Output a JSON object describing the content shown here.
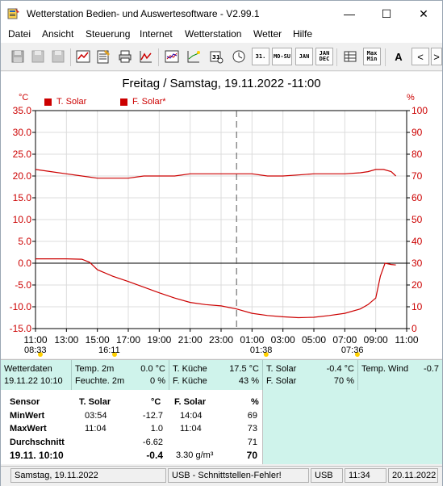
{
  "window": {
    "title": "Wetterstation Bedien- und Auswertesoftware - V2.99.1",
    "minimize_glyph": "—",
    "maximize_glyph": "☐",
    "close_glyph": "✕"
  },
  "menu": [
    "Datei",
    "Ansicht",
    "Steuerung",
    "Internet",
    "Wetterstation",
    "Wetter",
    "Hilfe"
  ],
  "toolbar": {
    "week_label": "MO-SU",
    "week_label2": "",
    "day_label": "31.",
    "month_label": "JAN",
    "year_label1": "JAN",
    "year_label2": "DEC",
    "maxmin_label1": "Max",
    "maxmin_label2": "Min",
    "font_label": "A",
    "prev_label": "<",
    "next_label": ">",
    "icons": [
      "save-icon",
      "save-disabled-icon",
      "chart-icon",
      "notes-icon",
      "print-icon",
      "graph-icon",
      "line-chart-icon",
      "plot-icon",
      "calendar-day-icon",
      "clock-icon"
    ]
  },
  "chart_data": {
    "type": "line",
    "title": "Freitag / Samstag, 19.11.2022  -11:00",
    "y_left_unit": "°C",
    "y_right_unit": "%",
    "ylim_left": [
      -15,
      35
    ],
    "ylim_right": [
      0,
      100
    ],
    "yticks_left": [
      "35.0",
      "30.0",
      "25.0",
      "20.0",
      "15.0",
      "10.0",
      "5.0",
      "0.0",
      "-5.0",
      "-10.0",
      "-15.0"
    ],
    "yticks_right": [
      "100",
      "90",
      "80",
      "70",
      "60",
      "50",
      "40",
      "30",
      "20",
      "10",
      "0"
    ],
    "xticks": [
      "11:00",
      "13:00",
      "15:00",
      "17:00",
      "19:00",
      "21:00",
      "23:00",
      "01:00",
      "03:00",
      "05:00",
      "07:00",
      "09:00",
      "11:00"
    ],
    "x_range_hours": [
      0,
      24
    ],
    "grid": true,
    "legend": "top-left",
    "colors": {
      "series": "#cc0000",
      "grid": "#dcdcdc",
      "axis": "#000000"
    },
    "markers": [
      {
        "label": "08:33",
        "x": 0
      },
      {
        "label": "16:11",
        "x": 4.8
      },
      {
        "label": "01:38",
        "x": 14.6
      },
      {
        "label": "07:36",
        "x": 20.5
      }
    ],
    "midnight_x": 13,
    "series": [
      {
        "name": "T. Solar",
        "axis": "left",
        "x": [
          0,
          1,
          2,
          3,
          3.5,
          4,
          5,
          6,
          7,
          8,
          9,
          10,
          11,
          12,
          13,
          14,
          15,
          16,
          17,
          18,
          19,
          20,
          21,
          21.5,
          22,
          22.3,
          22.6,
          23,
          23.3
        ],
        "y": [
          1,
          1,
          1,
          0.9,
          0.2,
          -1.5,
          -3,
          -4.2,
          -5.5,
          -6.8,
          -8,
          -9,
          -9.5,
          -9.8,
          -10.5,
          -11.5,
          -12,
          -12.3,
          -12.5,
          -12.4,
          -12,
          -11.5,
          -10.5,
          -9.5,
          -8,
          -3,
          0,
          -0.3,
          -0.4
        ]
      },
      {
        "name": "F. Solar*",
        "axis": "right",
        "x": [
          0,
          1,
          2,
          3,
          4,
          5,
          6,
          7,
          8,
          9,
          10,
          11,
          12,
          13,
          14,
          15,
          16,
          17,
          18,
          19,
          20,
          21,
          21.5,
          22,
          22.5,
          23,
          23.3
        ],
        "y": [
          73,
          72,
          71,
          70,
          69,
          69,
          69,
          70,
          70,
          70,
          71,
          71,
          71,
          71,
          71,
          70,
          70,
          70.5,
          71,
          71,
          71,
          71.5,
          72,
          73,
          73,
          72,
          70
        ]
      }
    ]
  },
  "current": {
    "wetterdaten_label": "Wetterdaten",
    "wetterdaten_time": "19.11.22 10:10",
    "temp2m_label": "Temp. 2m",
    "temp2m_value": "0.0 °C",
    "feuchte2m_label": "Feuchte. 2m",
    "feuchte2m_value": "0 %",
    "tkueche_label": "T. Küche",
    "tkueche_value": "17.5 °C",
    "fkueche_label": "F. Küche",
    "fkueche_value": "43 %",
    "tsolar_label": "T. Solar",
    "tsolar_value": "-0.4 °C",
    "fsolar_label": "F. Solar",
    "fsolar_value": "70 %",
    "wind_label": "Temp. Wind",
    "wind_value": "-0.7"
  },
  "stats": {
    "sensor_label": "Sensor",
    "col1_header": "T. Solar",
    "col1_unit": "°C",
    "col2_header": "F. Solar",
    "col2_unit": "%",
    "min_label": "MinWert",
    "min_time1": "03:54",
    "min_value1": "-12.7",
    "min_time2": "14:04",
    "min_value2": "69",
    "max_label": "MaxWert",
    "max_time1": "11:04",
    "max_value1": "1.0",
    "max_time2": "11:04",
    "max_value2": "73",
    "avg_label": "Durchschnitt",
    "avg_value1": "-6.62",
    "avg_value2": "71",
    "now_label": "19.11. 10:10",
    "now_value1": "-0.4",
    "now_extra2": "3.30 g/m³",
    "now_value2": "70"
  },
  "status": {
    "date": "Samstag, 19.11.2022",
    "connection": "USB - Schnittstellen-Fehler!",
    "port": "USB",
    "time": "11:34",
    "today": "20.11.2022"
  }
}
